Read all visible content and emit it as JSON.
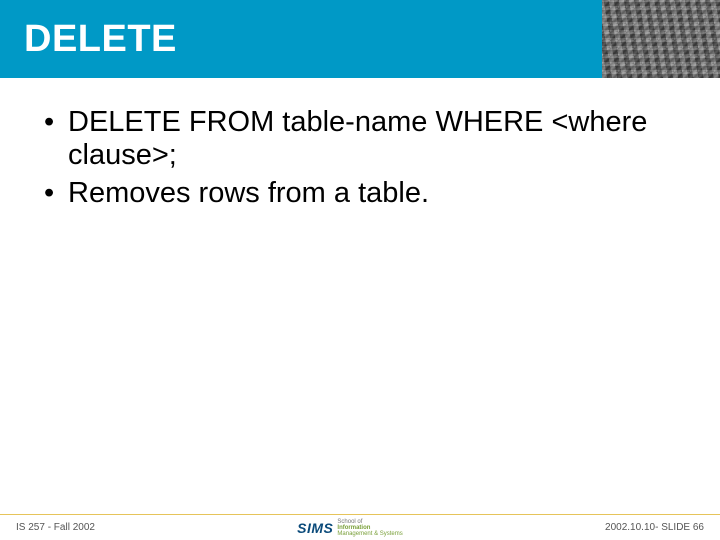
{
  "header": {
    "title": "DELETE"
  },
  "content": {
    "bullets": [
      "DELETE FROM table-name WHERE <where clause>;",
      "Removes rows from a table."
    ]
  },
  "footer": {
    "left": "IS 257 - Fall 2002",
    "logo": {
      "main": "SIMS",
      "line1": "School of",
      "line2": "Information",
      "line3": "Management & Systems"
    },
    "right": "2002.10.10- SLIDE 66"
  }
}
